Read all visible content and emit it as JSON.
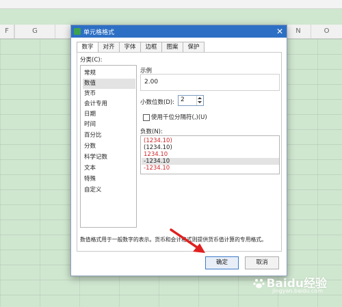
{
  "columns": [
    "F",
    "G",
    "N",
    "O"
  ],
  "dialog": {
    "title": "单元格格式",
    "tabs": [
      "数字",
      "对齐",
      "字体",
      "边框",
      "图案",
      "保护"
    ],
    "active_tab": "数字",
    "category_label": "分类(C):",
    "categories": [
      "常规",
      "数值",
      "货币",
      "会计专用",
      "日期",
      "时间",
      "百分比",
      "分数",
      "科学记数",
      "文本",
      "特殊",
      "自定义"
    ],
    "selected_category": "数值",
    "sample_label": "示例",
    "sample_value": "2.00",
    "decimal_label": "小数位数(D):",
    "decimal_value": "2",
    "thousands_label": "使用千位分隔符(,)(U)",
    "thousands_checked": false,
    "negative_label": "负数(N):",
    "negative_options": [
      {
        "text": "(1234.10)",
        "color": "#d0262b"
      },
      {
        "text": "(1234.10)",
        "color": "#222222"
      },
      {
        "text": "1234.10",
        "color": "#d0262b"
      },
      {
        "text": "-1234.10",
        "color": "#222222"
      },
      {
        "text": "-1234.10",
        "color": "#d0262b"
      }
    ],
    "selected_negative": "-1234.10",
    "description": "数值格式用于一般数字的表示。货币和会计格式则提供货币值计算的专用格式。",
    "ok_label": "确定",
    "cancel_label": "取消"
  },
  "watermark": {
    "brand": "Baidu经验",
    "url": "jingyan.baidu.com"
  },
  "colors": {
    "titlebar": "#2d6fc4",
    "sheet_bg": "#cfe6cf",
    "arrow": "#e02020",
    "negative_red": "#d0262b"
  }
}
